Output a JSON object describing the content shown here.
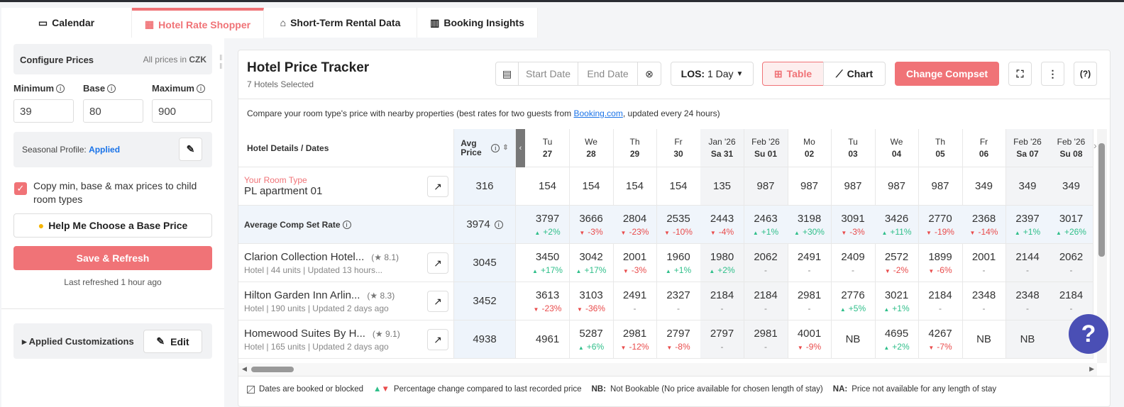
{
  "tabs": [
    {
      "label": "Calendar",
      "icon": "calendar-icon"
    },
    {
      "label": "Hotel Rate Shopper",
      "icon": "hotel-icon",
      "active": true
    },
    {
      "label": "Short-Term Rental Data",
      "icon": "house-icon"
    },
    {
      "label": "Booking Insights",
      "icon": "building-icon"
    }
  ],
  "config": {
    "title": "Configure Prices",
    "currency_note": "All prices in ",
    "currency": "CZK",
    "minimum_label": "Minimum",
    "base_label": "Base",
    "maximum_label": "Maximum",
    "minimum": "39",
    "base": "80",
    "maximum": "900",
    "seasonal_label": "Seasonal Profile: ",
    "seasonal_value": "Applied",
    "copy_label": "Copy min, base & max prices to child room types",
    "copy_checked": true,
    "help_button": "Help Me Choose a Base Price",
    "save_button": "Save & Refresh",
    "last_refreshed": "Last refreshed 1 hour ago",
    "customizations_label": "Applied Customizations",
    "edit_button": "Edit"
  },
  "tracker": {
    "title": "Hotel Price Tracker",
    "subtitle": "7 Hotels Selected",
    "start_placeholder": "Start Date",
    "end_placeholder": "End Date",
    "los_label": "LOS:",
    "los_value": "1 Day",
    "table_label": "Table",
    "chart_label": "Chart",
    "compset_button": "Change Compset",
    "description": "Compare your room type's price with nearby properties (best rates for two guests from ",
    "description_link": "Booking.com",
    "description_end": ", updated every 24 hours)"
  },
  "colors": {
    "accent": "#f07377",
    "up": "#2fbf8a",
    "down": "#e94b4b",
    "link": "#1a73e8",
    "help": "#4a4fb5"
  },
  "table": {
    "header_label": "Hotel Details / Dates",
    "avg_header": "Avg Price",
    "dates": [
      {
        "top": "Tu",
        "bottom": "27"
      },
      {
        "top": "We",
        "bottom": "28"
      },
      {
        "top": "Th",
        "bottom": "29"
      },
      {
        "top": "Fr",
        "bottom": "30"
      },
      {
        "top": "Jan '26",
        "bottom": "Sa 31",
        "weekend": true
      },
      {
        "top": "Feb '26",
        "bottom": "Su 01",
        "weekend": true
      },
      {
        "top": "Mo",
        "bottom": "02"
      },
      {
        "top": "Tu",
        "bottom": "03"
      },
      {
        "top": "We",
        "bottom": "04"
      },
      {
        "top": "Th",
        "bottom": "05"
      },
      {
        "top": "Fr",
        "bottom": "06"
      },
      {
        "top": "Feb '26",
        "bottom": "Sa 07",
        "weekend": true
      },
      {
        "top": "Feb '26",
        "bottom": "Su 08",
        "weekend": true
      }
    ],
    "rows": [
      {
        "kind": "own",
        "tag": "Your Room Type",
        "name": "PL apartment 01",
        "avg": "316",
        "cells": [
          [
            "154",
            ""
          ],
          [
            "154",
            ""
          ],
          [
            "154",
            ""
          ],
          [
            "154",
            ""
          ],
          [
            "135",
            ""
          ],
          [
            "987",
            ""
          ],
          [
            "987",
            ""
          ],
          [
            "987",
            ""
          ],
          [
            "987",
            ""
          ],
          [
            "987",
            ""
          ],
          [
            "349",
            ""
          ],
          [
            "349",
            ""
          ],
          [
            "349",
            ""
          ]
        ]
      },
      {
        "kind": "avg",
        "name": "Average Comp Set Rate",
        "avg": "3974",
        "cells": [
          [
            "3797",
            "+2%"
          ],
          [
            "3666",
            "-3%"
          ],
          [
            "2804",
            "-23%"
          ],
          [
            "2535",
            "-10%"
          ],
          [
            "2443",
            "-4%"
          ],
          [
            "2463",
            "+1%"
          ],
          [
            "3198",
            "+30%"
          ],
          [
            "3091",
            "-3%"
          ],
          [
            "3426",
            "+11%"
          ],
          [
            "2770",
            "-19%"
          ],
          [
            "2368",
            "-14%"
          ],
          [
            "2397",
            "+1%"
          ],
          [
            "3017",
            "+26%"
          ]
        ]
      },
      {
        "kind": "hotel",
        "name": "Clarion Collection Hotel...",
        "rating": "8.1",
        "meta": "Hotel | 44 units | Updated 13 hours...",
        "avg": "3045",
        "cells": [
          [
            "3450",
            "+17%"
          ],
          [
            "3042",
            "+17%"
          ],
          [
            "2001",
            "-3%"
          ],
          [
            "1960",
            "+1%"
          ],
          [
            "1980",
            "+2%"
          ],
          [
            "2062",
            "-"
          ],
          [
            "2491",
            "-"
          ],
          [
            "2409",
            "-"
          ],
          [
            "2572",
            "-2%"
          ],
          [
            "1899",
            "-6%"
          ],
          [
            "2001",
            "-"
          ],
          [
            "2144",
            "-"
          ],
          [
            "2062",
            "-"
          ]
        ]
      },
      {
        "kind": "hotel",
        "name": "Hilton Garden Inn Arlin...",
        "rating": "8.3",
        "meta": "Hotel | 190 units | Updated 2 days ago",
        "avg": "3452",
        "cells": [
          [
            "3613",
            "-23%"
          ],
          [
            "3103",
            "-36%"
          ],
          [
            "2491",
            "-"
          ],
          [
            "2327",
            "-"
          ],
          [
            "2184",
            "-"
          ],
          [
            "2184",
            "-"
          ],
          [
            "2981",
            "-"
          ],
          [
            "2776",
            "+5%"
          ],
          [
            "3021",
            "+1%"
          ],
          [
            "2184",
            "-"
          ],
          [
            "2348",
            "-"
          ],
          [
            "2348",
            "-"
          ],
          [
            "2184",
            "-"
          ]
        ]
      },
      {
        "kind": "hotel",
        "name": "Homewood Suites By H...",
        "rating": "9.1",
        "meta": "Hotel | 165 units | Updated 2 days ago",
        "avg": "4938",
        "cells": [
          [
            "4961",
            ""
          ],
          [
            "5287",
            "+6%"
          ],
          [
            "2981",
            "-12%"
          ],
          [
            "2797",
            "-8%"
          ],
          [
            "2797",
            "-"
          ],
          [
            "2981",
            "-"
          ],
          [
            "4001",
            "-9%"
          ],
          [
            "NB",
            ""
          ],
          [
            "4695",
            "+2%"
          ],
          [
            "4267",
            "-7%"
          ],
          [
            "NB",
            ""
          ],
          [
            "NB",
            ""
          ],
          [
            "",
            ""
          ]
        ]
      }
    ]
  },
  "legend": {
    "blocked": "Dates are booked or blocked",
    "pct": "Percentage change compared to last recorded price",
    "nb_key": "NB:",
    "nb": "Not Bookable (No price available for chosen length of stay)",
    "na_key": "NA:",
    "na": "Price not available for any length of stay"
  }
}
